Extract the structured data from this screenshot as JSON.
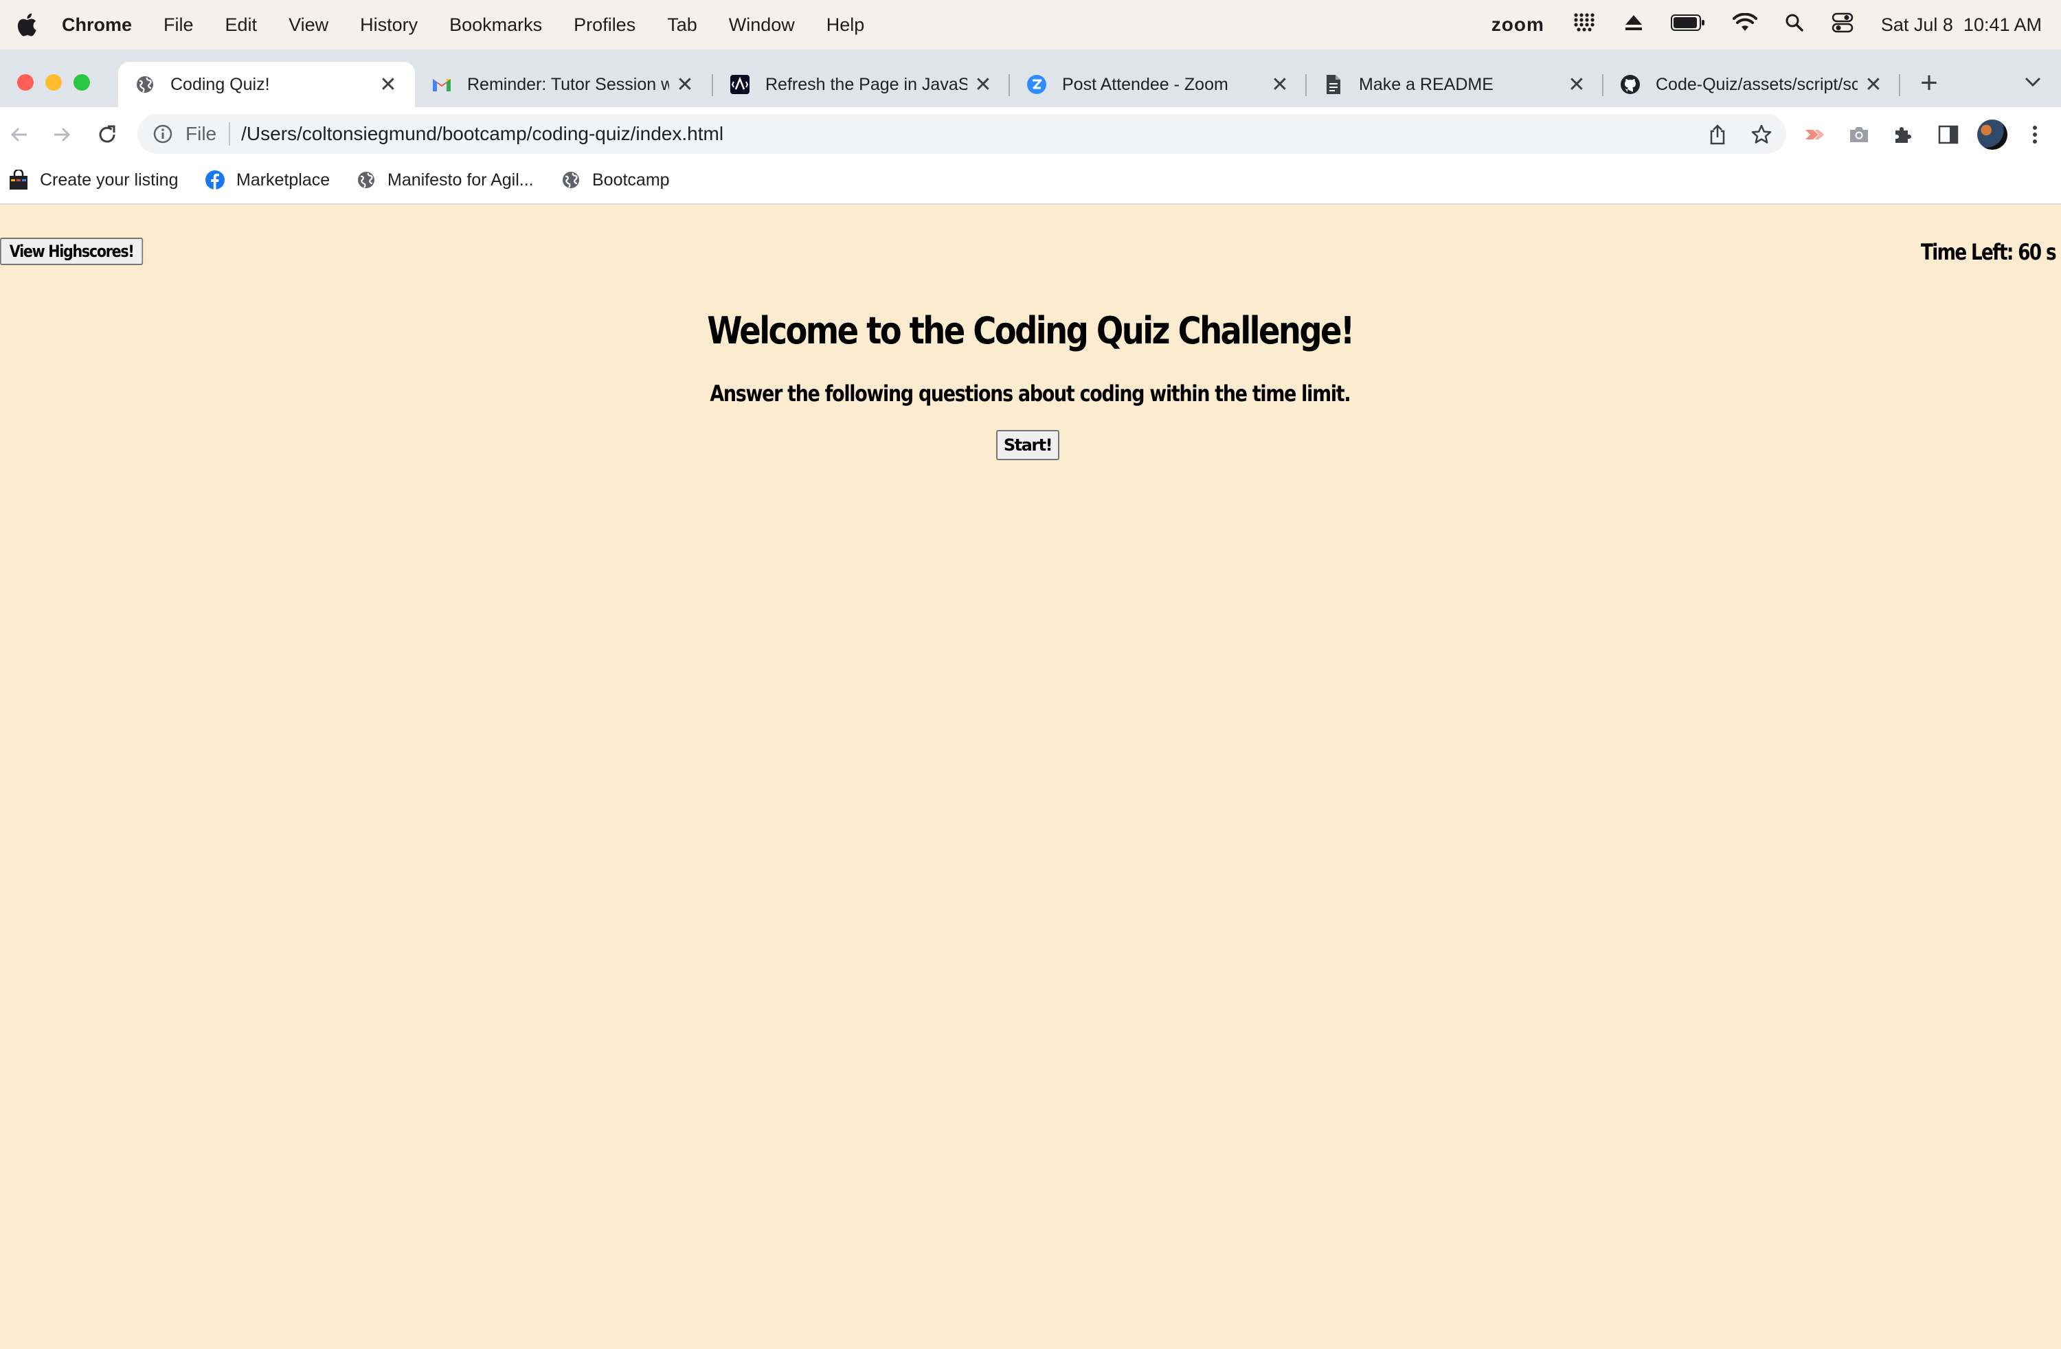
{
  "menubar": {
    "app": "Chrome",
    "items": [
      "File",
      "Edit",
      "View",
      "History",
      "Bookmarks",
      "Profiles",
      "Tab",
      "Window",
      "Help"
    ],
    "zoom": "zoom",
    "datetime": "Sat Jul 8  10:41 AM"
  },
  "tabs": [
    {
      "title": "Coding Quiz!",
      "icon": "globe-icon",
      "active": true
    },
    {
      "title": "Reminder: Tutor Session wi",
      "icon": "gmail-icon",
      "active": false
    },
    {
      "title": "Refresh the Page in JavaSc",
      "icon": "freecodecamp-icon",
      "active": false
    },
    {
      "title": "Post Attendee - Zoom",
      "icon": "zoom-icon",
      "active": false
    },
    {
      "title": "Make a README",
      "icon": "document-icon",
      "active": false
    },
    {
      "title": "Code-Quiz/assets/script/sc",
      "icon": "github-icon",
      "active": false
    }
  ],
  "toolbar": {
    "file_label": "File",
    "url": "/Users/coltonsiegmund/bootcamp/coding-quiz/index.html"
  },
  "bookmarks": [
    {
      "label": "Create your listing",
      "icon": "shopping-bag-icon"
    },
    {
      "label": "Marketplace",
      "icon": "facebook-icon"
    },
    {
      "label": "Manifesto for Agil...",
      "icon": "globe-icon"
    },
    {
      "label": "Bootcamp",
      "icon": "globe-icon"
    }
  ],
  "page": {
    "highscores_label": "View Highscores!",
    "timer": "Time Left: 60 s",
    "heading": "Welcome to the Coding Quiz Challenge!",
    "subheading": "Answer the following questions about coding within the time limit.",
    "start_label": "Start!"
  },
  "colors": {
    "page_background": "#fbebcf",
    "tabstrip": "#dfe3ea",
    "close": "#ff5f57",
    "minimize": "#febc2e",
    "zoom": "#28c840"
  }
}
